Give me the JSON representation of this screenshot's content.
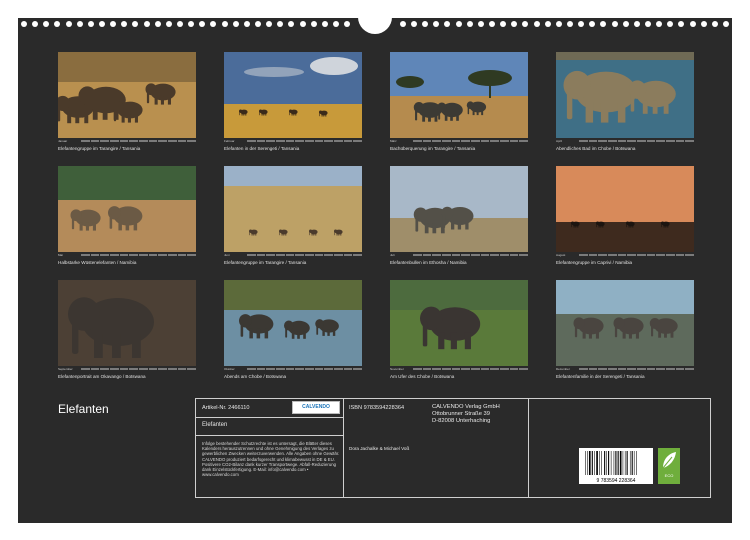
{
  "calendar": {
    "title": "Elefanten",
    "photos": [
      {
        "caption": "Elefantengruppe im Tarangire / Tansania",
        "month": "Januar"
      },
      {
        "caption": "Elefanten in der Serengeti / Tansania",
        "month": "Februar"
      },
      {
        "caption": "Bachüberquerung im Tarangire / Tansania",
        "month": "März"
      },
      {
        "caption": "Abendliches Bad im Chobe / Botswana",
        "month": "April"
      },
      {
        "caption": "Halbstarke Wüstenelefanten / Namibia",
        "month": "Mai"
      },
      {
        "caption": "Elefantengruppe im Tarangire / Tansania",
        "month": "Juni"
      },
      {
        "caption": "Elefantenbullen im Ethosha / Namibia",
        "month": "Juli"
      },
      {
        "caption": "Elefantengruppe im Caprivi / Namibia",
        "month": "August"
      },
      {
        "caption": "Elefantenportrait am Okavango / Botswana",
        "month": "September"
      },
      {
        "caption": "Abends am Chobe / Botswana",
        "month": "Oktober"
      },
      {
        "caption": "Am Ufer des Chobe / Botswana",
        "month": "November"
      },
      {
        "caption": "Elefantenfamilie in der Serengeti / Tansania",
        "month": "Dezember"
      }
    ]
  },
  "info": {
    "article_label": "Artikel-Nr. 2466110",
    "publisher_logo": "CALVENDO",
    "product_title": "Elefanten",
    "notice": "Infolge bestehender Schutzrechte ist es untersagt, die Blätter dieses Kalenders herauszutrennen und ohne Genehmigung des Verlages zu gewerblichen Zwecken weiterzuverwenden. Alle Angaben ohne Gewähr. CALVENDO produziert bedarfsgerecht und klimabewusst in DE & EU. Positivere CO2-Bilanz dank kurzer Transportwege. Abfall-Reduzierung dank Einzelstückfertigung. E-Mail: info@calvendo.com • www.calvendo.com",
    "isbn": "ISBN 9783594228364",
    "authors": "Dora Jachalke & Michael Voß",
    "publisher_name": "CALVENDO Verlag GmbH",
    "publisher_street": "Ottobrunner Straße 39",
    "publisher_city": "D-82008 Unterhaching",
    "barcode_number": "9 783594 228364",
    "eco_label": "ECO"
  },
  "colors": {
    "sheet": "#2a2a2a",
    "text": "#e0e0e0",
    "accent_green": "#6fae3c"
  }
}
